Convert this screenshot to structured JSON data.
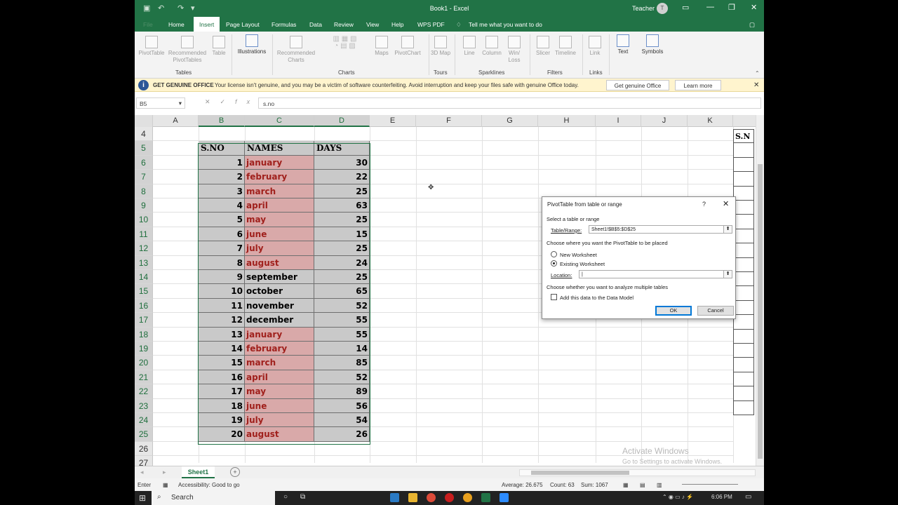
{
  "window": {
    "title": "Book1 - Excel",
    "user": "Teacher",
    "avatar_initial": "T"
  },
  "tabs": [
    {
      "label": "File"
    },
    {
      "label": "Home"
    },
    {
      "label": "Insert",
      "active": true
    },
    {
      "label": "Page Layout"
    },
    {
      "label": "Formulas"
    },
    {
      "label": "Data"
    },
    {
      "label": "Review"
    },
    {
      "label": "View"
    },
    {
      "label": "Help"
    },
    {
      "label": "WPS PDF"
    },
    {
      "label": "Tell me what you want to do"
    }
  ],
  "ribbon": {
    "pivottable": "PivotTable",
    "recommended_pivottables": "Recommended PivotTables",
    "table": "Table",
    "illustrations": "Illustrations",
    "recommended_charts": "Recommended Charts",
    "maps": "Maps",
    "pivotchart": "PivotChart",
    "map3d": "3D Map",
    "line": "Line",
    "column": "Column",
    "winloss": "Win/ Loss",
    "slicer": "Slicer",
    "timeline": "Timeline",
    "link": "Link",
    "text": "Text",
    "symbols": "Symbols",
    "groups": {
      "tables": "Tables",
      "charts": "Charts",
      "tours": "Tours",
      "sparklines": "Sparklines",
      "filters": "Filters",
      "links": "Links"
    }
  },
  "infobar": {
    "title": "GET GENUINE OFFICE",
    "message": "Your license isn't genuine, and you may be a victim of software counterfeiting. Avoid interruption and keep your files safe with genuine Office today.",
    "btn_genuine": "Get genuine Office",
    "btn_learn": "Learn more"
  },
  "formula_bar": {
    "name_box": "B5",
    "fx": "fx",
    "content": "s.no"
  },
  "columns": [
    "A",
    "B",
    "C",
    "D",
    "E",
    "F",
    "G",
    "H",
    "I",
    "J",
    "K"
  ],
  "table": {
    "headers": [
      "S.NO",
      "NAMES",
      "DAYS"
    ],
    "rows": [
      {
        "n": "1",
        "name": "january",
        "days": "30"
      },
      {
        "n": "2",
        "name": "february",
        "days": "22"
      },
      {
        "n": "3",
        "name": "march",
        "days": "25"
      },
      {
        "n": "4",
        "name": "april",
        "days": "63"
      },
      {
        "n": "5",
        "name": "may",
        "days": "25"
      },
      {
        "n": "6",
        "name": "june",
        "days": "15"
      },
      {
        "n": "7",
        "name": "july",
        "days": "25"
      },
      {
        "n": "8",
        "name": "august",
        "days": "24"
      },
      {
        "n": "9",
        "name": "september",
        "days": "25"
      },
      {
        "n": "10",
        "name": "october",
        "days": "65"
      },
      {
        "n": "11",
        "name": "november",
        "days": "52"
      },
      {
        "n": "12",
        "name": "december",
        "days": "55"
      },
      {
        "n": "13",
        "name": "january",
        "days": "55"
      },
      {
        "n": "14",
        "name": "february",
        "days": "14"
      },
      {
        "n": "15",
        "name": "march",
        "days": "85"
      },
      {
        "n": "16",
        "name": "april",
        "days": "52"
      },
      {
        "n": "17",
        "name": "may",
        "days": "89"
      },
      {
        "n": "18",
        "name": "june",
        "days": "56"
      },
      {
        "n": "19",
        "name": "july",
        "days": "54"
      },
      {
        "n": "20",
        "name": "august",
        "days": "26"
      }
    ]
  },
  "right_header": "S.N",
  "dialog": {
    "title": "PivotTable from table or range",
    "help": "?",
    "close": "✕",
    "select_label": "Select a table or range",
    "range_label": "Table/Range:",
    "range_value": "Sheet1!$B$5:$D$25",
    "place_label": "Choose where you want the PivotTable to be placed",
    "new_ws": "New Worksheet",
    "existing_ws": "Existing Worksheet",
    "location_label": "Location:",
    "location_value": "|",
    "multi_label": "Choose whether you want to analyze multiple tables",
    "add_model": "Add this data to the Data Model",
    "ok": "OK",
    "cancel": "Cancel"
  },
  "sheet_tab": "Sheet1",
  "status": {
    "mode": "Enter",
    "accessibility": "Accessibility: Good to go",
    "average": "Average: 26.675",
    "count": "Count: 63",
    "sum": "Sum: 1067"
  },
  "watermark": {
    "line1": "Activate Windows",
    "line2": "Go to Settings to activate Windows."
  },
  "taskbar": {
    "search": "Search",
    "time": "6:06 PM"
  }
}
